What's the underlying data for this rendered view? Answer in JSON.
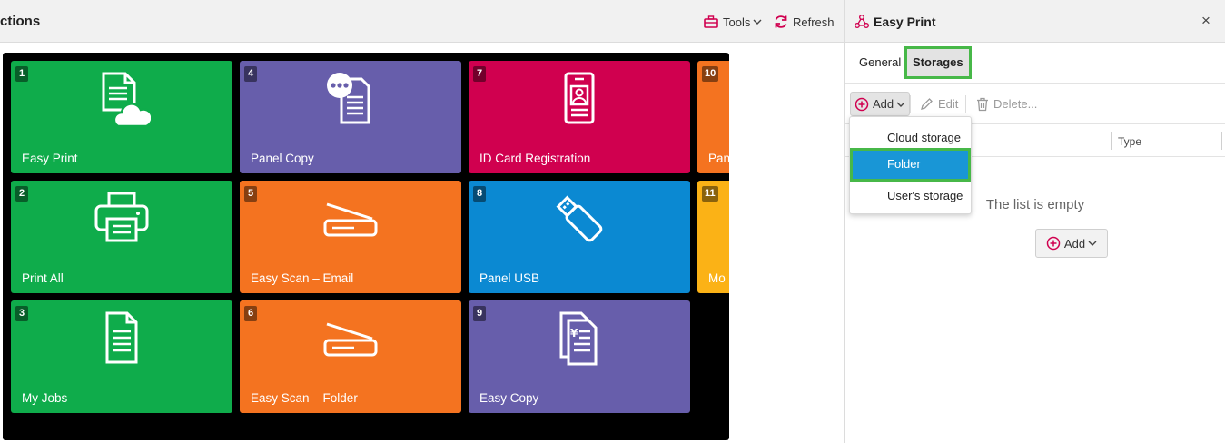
{
  "left_pane": {
    "title": "ctions",
    "tools_label": "Tools",
    "refresh_label": "Refresh"
  },
  "tiles": [
    {
      "num": "1",
      "label": "Easy Print",
      "color": "#0fac4b",
      "icon": "print-cloud-icon"
    },
    {
      "num": "4",
      "label": "Panel Copy",
      "color": "#675eab",
      "icon": "panel-copy-icon"
    },
    {
      "num": "7",
      "label": "ID Card Registration",
      "color": "#d0004f",
      "icon": "id-card-icon"
    },
    {
      "num": "10",
      "label": "Pan",
      "color": "#f47320",
      "icon": ""
    },
    {
      "num": "2",
      "label": "Print All",
      "color": "#0fac4b",
      "icon": "printer-icon"
    },
    {
      "num": "5",
      "label": "Easy Scan – Email",
      "color": "#f47320",
      "icon": "scanner-icon"
    },
    {
      "num": "8",
      "label": "Panel USB",
      "color": "#0b89d2",
      "icon": "usb-icon"
    },
    {
      "num": "11",
      "label": "Mo",
      "color": "#fbb216",
      "icon": ""
    },
    {
      "num": "3",
      "label": "My Jobs",
      "color": "#0fac4b",
      "icon": "document-icon"
    },
    {
      "num": "6",
      "label": "Easy Scan – Folder",
      "color": "#f47320",
      "icon": "scanner-icon"
    },
    {
      "num": "9",
      "label": "Easy Copy",
      "color": "#675eab",
      "icon": "easy-copy-icon"
    }
  ],
  "right_pane": {
    "title": "Easy Print",
    "close_label": "×",
    "tabs": [
      {
        "label": "General",
        "active": false
      },
      {
        "label": "Storages",
        "active": true
      }
    ],
    "toolbar": {
      "add_label": "Add",
      "edit_label": "Edit",
      "delete_label": "Delete..."
    },
    "columns": {
      "type_label": "Type"
    },
    "empty_text": "The list is empty",
    "empty_add_label": "Add"
  },
  "dropdown": {
    "items": [
      {
        "label": "Cloud storage",
        "selected": false
      },
      {
        "label": "Folder",
        "selected": true
      },
      {
        "label": "User's storage",
        "selected": false
      }
    ]
  },
  "colors": {
    "highlight_outline": "#47b848",
    "selected_item": "#1996d6",
    "add_icon": "#d0004f"
  }
}
